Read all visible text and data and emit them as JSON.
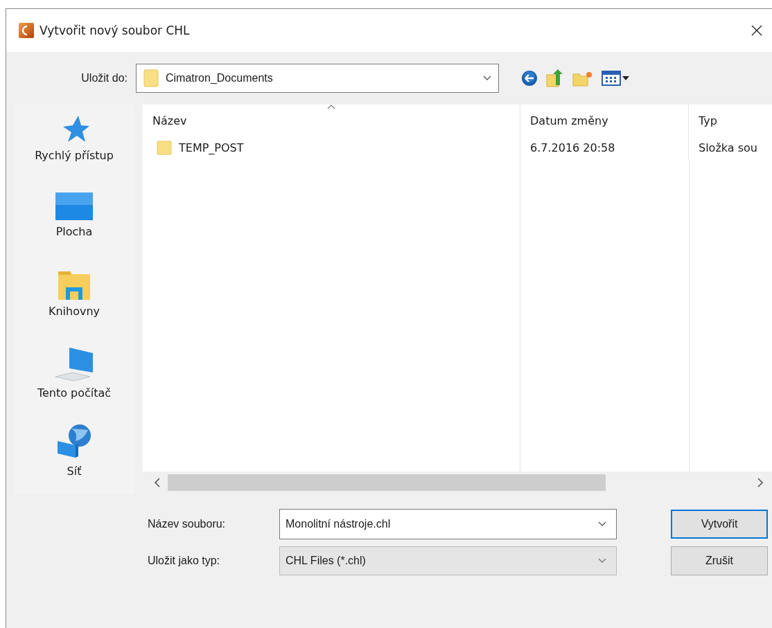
{
  "window": {
    "title": "Vytvořit nový soubor CHL"
  },
  "location": {
    "label": "Uložit do:",
    "value": "Cimatron_Documents"
  },
  "sidebar": {
    "items": [
      {
        "label": "Rychlý přístup",
        "kind": "star"
      },
      {
        "label": "Plocha",
        "kind": "desktop"
      },
      {
        "label": "Knihovny",
        "kind": "library"
      },
      {
        "label": "Tento počítač",
        "kind": "computer"
      },
      {
        "label": "Síť",
        "kind": "network"
      }
    ]
  },
  "file_list": {
    "columns": [
      {
        "label": "Název",
        "sorted": true
      },
      {
        "label": "Datum změny",
        "sorted": false
      },
      {
        "label": "Typ",
        "sorted": false
      }
    ],
    "rows": [
      {
        "name": "TEMP_POST",
        "date": "6.7.2016 20:58",
        "type": "Složka sou"
      }
    ]
  },
  "file_name": {
    "label": "Název souboru:",
    "value": "Monolitní nástroje.chl"
  },
  "file_type": {
    "label": "Uložit jako typ:",
    "value": "CHL Files (*.chl)"
  },
  "buttons": [
    {
      "label": "Vytvořit",
      "default": true
    },
    {
      "label": "Zrušit",
      "default": false
    }
  ]
}
